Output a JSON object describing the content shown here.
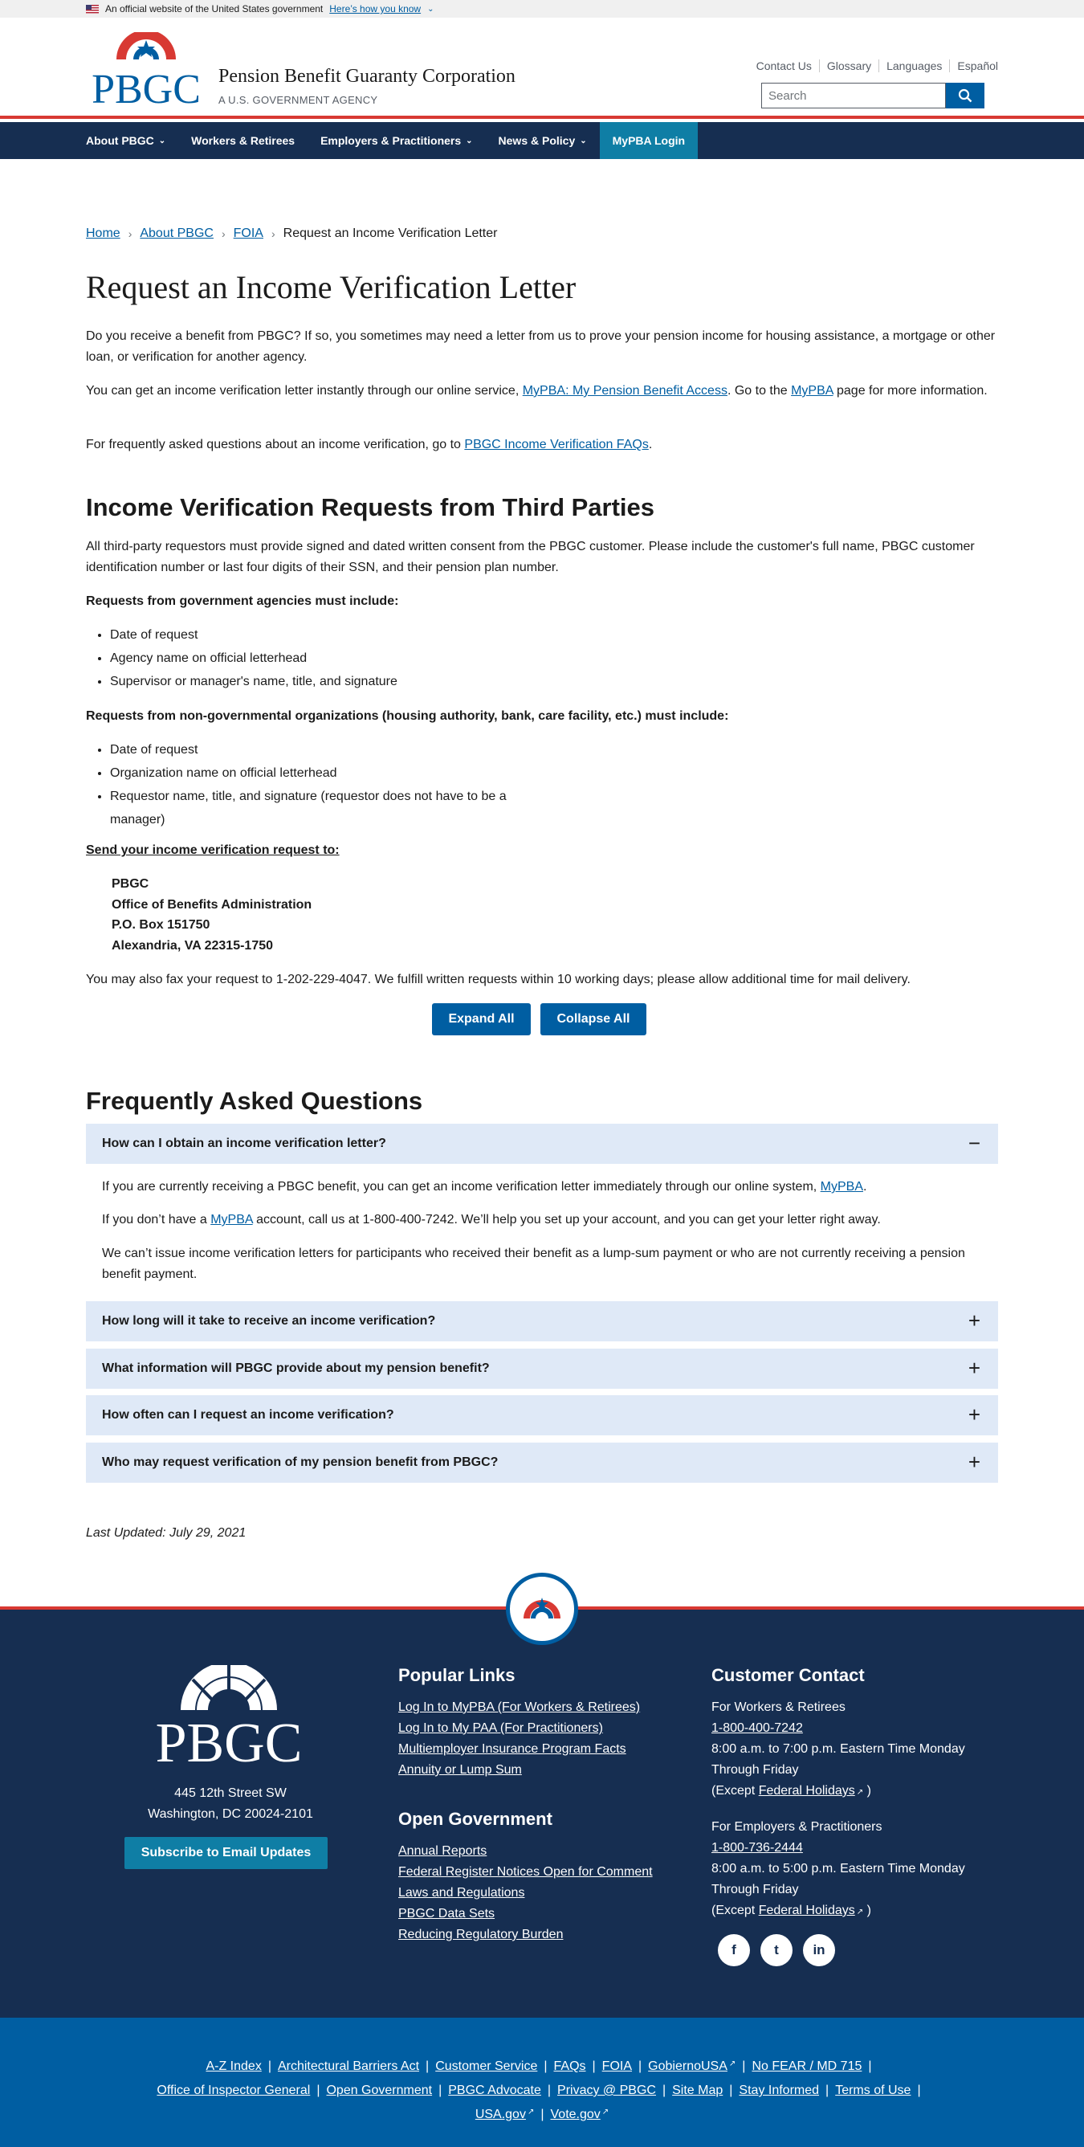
{
  "gov_banner": {
    "text": "An official website of the United States government",
    "link": "Here’s how you know"
  },
  "header": {
    "logo_text": "PBGC",
    "agency_name": "Pension Benefit Guaranty Corporation",
    "agency_sub": "A U.S. GOVERNMENT AGENCY",
    "utility_links": [
      "Contact Us",
      "Glossary",
      "Languages",
      "Español"
    ],
    "search_placeholder": "Search"
  },
  "nav": {
    "items": [
      "About PBGC",
      "Workers & Retirees",
      "Employers & Practitioners",
      "News & Policy"
    ],
    "login": "MyPBA Login"
  },
  "breadcrumb": [
    "Home",
    "About PBGC",
    "FOIA",
    "Request an Income Verification Letter"
  ],
  "page_title": "Request an Income Verification Letter",
  "intro": {
    "p1": "Do you receive a benefit from PBGC? If so, you sometimes may need a letter from us to prove your pension income for housing assistance, a mortgage or other loan, or verification for another agency.",
    "p2_a": "You can get an income verification letter instantly through our online service, ",
    "p2_link1": "MyPBA: My Pension Benefit Access",
    "p2_b": ". Go to the ",
    "p2_link2": "MyPBA",
    "p2_c": " page for more information.",
    "p3_a": "For frequently asked questions about an income verification, go to ",
    "p3_link": "PBGC Income Verification FAQs",
    "p3_b": "."
  },
  "third_parties": {
    "heading": "Income Verification Requests from Third Parties",
    "text": "All third-party requestors must provide signed and dated written consent from the PBGC customer. Please include the customer's full name, PBGC customer identification number or last four digits of their SSN, and their pension plan number.",
    "gov_heading": "Requests from government agencies must include:",
    "gov_items": [
      "Date of request",
      "Agency name on official letterhead",
      "Supervisor or manager's name, title, and signature"
    ],
    "nongov_heading": "Requests from non-governmental organizations (housing authority, bank, care facility, etc.) must include:",
    "nongov_items": [
      "Date of request",
      "Organization name on official letterhead",
      "Requestor name, title, and signature (requestor does not have to be a",
      "manager)"
    ],
    "send_heading": "Send your income verification request to:",
    "address": [
      "PBGC",
      "Office of Benefits Administration",
      "P.O. Box 151750",
      "Alexandria, VA 22315-1750"
    ],
    "fax_text": "You may also fax your request to 1-202-229-4047. We fulfill written requests within 10 working days; please allow additional time for mail delivery."
  },
  "buttons": {
    "expand": "Expand All",
    "collapse": "Collapse All"
  },
  "faq": {
    "heading": "Frequently Asked Questions",
    "q1": "How can I obtain an income verification letter?",
    "a1_p1_a": "If you are currently receiving a PBGC benefit, you can get an income verification letter immediately through our online system, ",
    "a1_p1_link": "MyPBA",
    "a1_p1_b": ".",
    "a1_p2_a": "If you don’t have a ",
    "a1_p2_link": "MyPBA",
    "a1_p2_b": " account, call us at 1-800-400-7242. We’ll help you set up your account, and you can get your letter right away.",
    "a1_p3": "We can’t issue income verification letters for participants who received their benefit as a lump-sum payment or who are not currently receiving a pension benefit payment.",
    "q2": "How long will it take to receive an income verification?",
    "q3": "What information will PBGC provide about my pension benefit?",
    "q4": "How often can I request an income verification?",
    "q5": "Who may request verification of my pension benefit from PBGC?",
    "expanded_symbol": "−",
    "collapsed_symbol": "+"
  },
  "last_updated": "Last Updated: July 29, 2021",
  "footer": {
    "logo_text": "PBGC",
    "address": [
      "445 12th Street SW",
      "Washington, DC 20024-2101"
    ],
    "subscribe": "Subscribe to Email Updates",
    "popular_heading": "Popular Links",
    "popular_links": [
      "Log In to MyPBA (For Workers & Retirees)",
      "Log In to My PAA (For Practitioners)",
      "Multiemployer Insurance Program Facts",
      "Annuity or Lump Sum"
    ],
    "open_heading": "Open Government",
    "open_links": [
      "Annual Reports",
      "Federal Register Notices Open for Comment",
      "Laws and Regulations",
      "PBGC Data Sets",
      "Reducing Regulatory Burden"
    ],
    "contact_heading": "Customer Contact",
    "workers_label": "For Workers & Retirees",
    "workers_phone": "1-800-400-7242",
    "workers_hours": "8:00 a.m. to 7:00 p.m. Eastern Time Monday Through Friday",
    "except_a": "(Except ",
    "holidays": "Federal Holidays",
    "except_b": " )",
    "employers_label": "For Employers & Practitioners",
    "employers_phone": "1-800-736-2444",
    "employers_hours": "8:00 a.m. to 5:00 p.m. Eastern Time Monday Through Friday",
    "social": [
      "f",
      "t",
      "in"
    ]
  },
  "bottom_links": {
    "row1": [
      "A-Z Index",
      "Architectural Barriers Act",
      "Customer Service",
      "FAQs",
      "FOIA",
      "GobiernoUSA",
      "No FEAR / MD 715"
    ],
    "row2": [
      "Office of Inspector General",
      "Open Government",
      "PBGC Advocate",
      "Privacy @ PBGC",
      "Site Map",
      "Stay Informed",
      "Terms of Use"
    ],
    "row3": [
      "USA.gov",
      "Vote.gov"
    ]
  },
  "colors": {
    "navy": "#162e51",
    "blue": "#005ea2",
    "teal": "#0f7ea5",
    "red": "#d83933",
    "accordion": "#dfe9f7"
  }
}
